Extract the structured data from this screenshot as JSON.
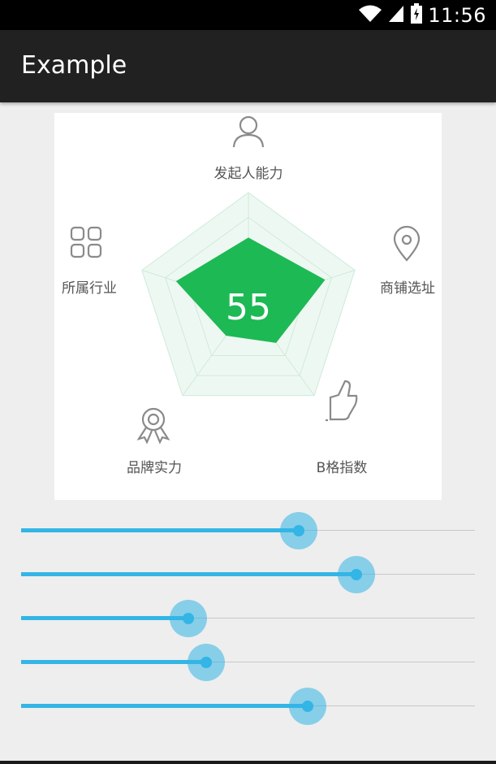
{
  "status_bar": {
    "time": "11:56",
    "icons": [
      "wifi-icon",
      "signal-icon",
      "battery-icon"
    ]
  },
  "app_bar": {
    "title": "Example"
  },
  "radar": {
    "score": "55",
    "labels": {
      "top": "发起人能力",
      "right": "商铺选址",
      "bottom_right": "B格指数",
      "bottom_left": "品牌实力",
      "left": "所属行业"
    },
    "icons": {
      "top": "person-icon",
      "right": "location-pin-icon",
      "bottom_right": "thumbs-up-icon",
      "bottom_left": "award-ribbon-icon",
      "left": "grid-icon"
    },
    "values": [
      0.6,
      0.72,
      0.42,
      0.34,
      0.68
    ],
    "colors": {
      "fill": "#1db954",
      "grid_fill": "#eef8f2",
      "grid_line": "#cdebd8"
    }
  },
  "sliders": {
    "values": [
      0.611,
      0.739,
      0.369,
      0.408,
      0.631
    ],
    "accent": "#33b5e5"
  }
}
